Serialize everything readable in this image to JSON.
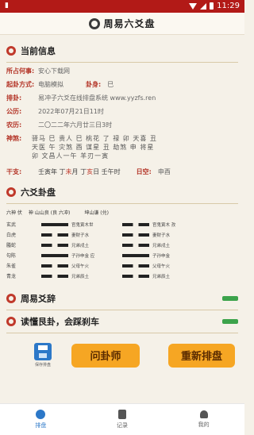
{
  "status_bar": {
    "carrier": "▮",
    "time": "11:29"
  },
  "title": "周易六爻盘",
  "current_info": {
    "section_title": "当前信息",
    "rows": {
      "topic": {
        "label": "所占何事:",
        "value": "安心下载网"
      },
      "method": {
        "label": "起卦方式:",
        "value": "电脑模拟",
        "gua_label": "卦身:",
        "gua_value": "巳"
      },
      "pan": {
        "label": "排卦:",
        "value": "易冲子六爻在线排盘系统 www.yyzfs.ren"
      },
      "gongli": {
        "label": "公历:",
        "value": "2022年07月21日11时"
      },
      "nongli": {
        "label": "农历:",
        "value": "二〇二二年六月廿三日3时"
      }
    },
    "shensha_label": "神煞:",
    "shensha_lines": [
      "驿马  巳 贵人  巳 桃花  了 禄  卯 天喜  丑",
      "天医  午 灾煞  酉 谋星  丑 劫煞  申 将星",
      "卯  文昌人一午  羊刃一寅"
    ],
    "ganzhi_label": "干支:",
    "ganzhi_parts": [
      {
        "text": "壬寅年 丁",
        "red": false
      },
      {
        "text": "未",
        "red": true
      },
      {
        "text": "月 丁",
        "red": false
      },
      {
        "text": "亥",
        "red": true
      },
      {
        "text": "日 壬午时",
        "red": false
      }
    ],
    "kong_label": "日空:",
    "kong_value": "申酉"
  },
  "liuyao": {
    "section_title": "六爻卦盘",
    "header": [
      "六神 伏",
      "神 山山良 (良 六冲)",
      "坤山谦 (兑)"
    ],
    "rows": [
      {
        "pos": "玄武",
        "left_broken": false,
        "left_text": "官鬼寅木世",
        "right_broken": true,
        "right_text": "官鬼寅木 孜"
      },
      {
        "pos": "白虎",
        "left_broken": true,
        "left_text": "妻财子水",
        "right_broken": true,
        "right_text": "妻财子水"
      },
      {
        "pos": "螣蛇",
        "left_broken": true,
        "left_text": "兄弟戌土",
        "right_broken": true,
        "right_text": "兄弟戌土"
      },
      {
        "pos": "勾陈",
        "left_broken": false,
        "left_text": "子孙申金 应",
        "right_broken": false,
        "right_text": "子孙申金"
      },
      {
        "pos": "朱雀",
        "left_broken": true,
        "left_text": "父母午火",
        "right_broken": true,
        "right_text": "父母午火"
      },
      {
        "pos": "青龙",
        "left_broken": true,
        "left_text": "兄弟辰土",
        "right_broken": true,
        "right_text": "兄弟辰土"
      }
    ]
  },
  "zhouyi": {
    "section_title": "周易爻辞"
  },
  "read": {
    "section_title": "读懂艮卦，会踩刹车"
  },
  "actions": {
    "save_label": "保存排盘",
    "ask_label": "问卦师",
    "repan_label": "重新排盘"
  },
  "nav": {
    "pan": "排盘",
    "record": "记录",
    "mine": "我的"
  }
}
